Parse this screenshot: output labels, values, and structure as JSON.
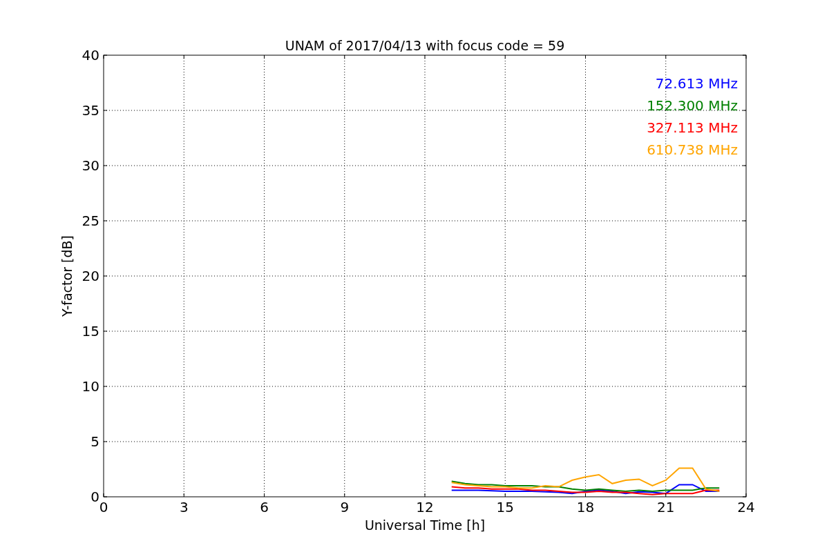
{
  "figure": {
    "chart_data": {
      "type": "line",
      "title": "UNAM of 2017/04/13 with focus code = 59",
      "xlabel": "Universal Time [h]",
      "ylabel": "Y-factor [dB]",
      "x": [
        13,
        13.5,
        14,
        14.5,
        15,
        15.5,
        16,
        16.5,
        17,
        17.5,
        18,
        18.5,
        19,
        19.5,
        20,
        20.5,
        21,
        21.5,
        22,
        22.5,
        23
      ],
      "series": [
        {
          "name": "72.613 MHz",
          "color": "#0000ff",
          "values": [
            0.6,
            0.6,
            0.6,
            0.55,
            0.5,
            0.5,
            0.5,
            0.45,
            0.4,
            0.3,
            0.5,
            0.6,
            0.5,
            0.3,
            0.45,
            0.4,
            0.3,
            1.1,
            1.1,
            0.5,
            0.5
          ]
        },
        {
          "name": "152.300 MHz",
          "color": "#008000",
          "values": [
            1.4,
            1.2,
            1.1,
            1.1,
            1.0,
            1.0,
            1.0,
            0.9,
            0.9,
            0.7,
            0.6,
            0.7,
            0.6,
            0.5,
            0.6,
            0.5,
            0.6,
            0.6,
            0.6,
            0.8,
            0.8
          ]
        },
        {
          "name": "327.113 MHz",
          "color": "#ff0000",
          "values": [
            0.9,
            0.8,
            0.8,
            0.7,
            0.7,
            0.7,
            0.6,
            0.6,
            0.5,
            0.4,
            0.4,
            0.5,
            0.4,
            0.4,
            0.3,
            0.2,
            0.3,
            0.3,
            0.3,
            0.6,
            0.6
          ]
        },
        {
          "name": "610.738 MHz",
          "color": "#ffa500",
          "values": [
            1.3,
            1.1,
            1.0,
            0.9,
            0.9,
            0.8,
            0.8,
            1.0,
            0.9,
            1.5,
            1.8,
            2.0,
            1.2,
            1.5,
            1.6,
            1.0,
            1.5,
            2.6,
            2.6,
            0.7,
            0.5
          ]
        }
      ],
      "grid": true,
      "xlim": [
        0,
        24
      ],
      "ylim": [
        0,
        40
      ],
      "xticks": [
        0,
        3,
        6,
        9,
        12,
        15,
        18,
        21,
        24
      ],
      "yticks": [
        0,
        5,
        10,
        15,
        20,
        25,
        30,
        35,
        40
      ]
    }
  }
}
